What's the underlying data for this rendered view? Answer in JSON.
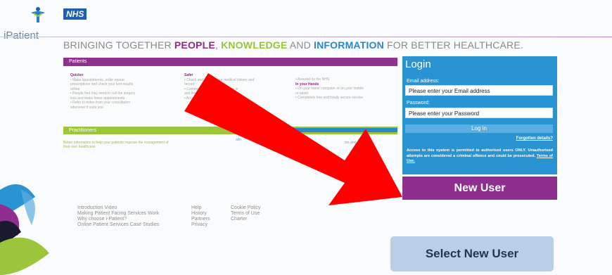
{
  "header": {
    "brand_name": "iPatient",
    "nhs_label": "NHS",
    "tagline_1": "BRINGING TOGETHER ",
    "tagline_people": "PEOPLE",
    "tagline_sep1": ", ",
    "tagline_knowledge": "KNOWLEDGE",
    "tagline_and": " AND ",
    "tagline_information": "INFORMATION",
    "tagline_end": " FOR BETTER HEALTHCARE."
  },
  "patients": {
    "bar_label": "Patients",
    "col1_heading": "Quicker",
    "col1_lines": [
      "• Make appointments, order repeat",
      "  prescriptions and check your test results",
      "  online",
      "• People find they need to call the surgery",
      "  less and make fewer appointments",
      "• Refer to notes from your consultation",
      "  whenever it suits you"
    ],
    "col2_heading": "Safer",
    "col2_lines": [
      "• Check and correct your medical history and",
      "  record",
      "• Communicate with consultants or",
      "  and feel involved",
      "• Access your records and when"
    ],
    "col3_heading": "In your Hands",
    "col3_lines": [
      "• Assured by the NHS",
      "• On your home computer or on your mobile",
      "  or tablet",
      "• Completely free and totally secure service"
    ]
  },
  "practitioners": {
    "bar_label": "Practitioners",
    "text": "Better information to help your patients improve the management of their own healthcare.",
    "side_note": "alth",
    "side_note2": "ms and"
  },
  "login": {
    "title": "Login",
    "email_label": "Email address:",
    "email_value": "Please enter your Email address",
    "password_label": "Password:",
    "password_value": "Please enter your Password",
    "login_button": "Log in",
    "forgot_link": "Forgotten details?",
    "warning_text": "Access to this system is permitted to authorised users ONLY. Unauthorised attempts are considered a criminal offence and could be prosecuted.",
    "terms_link": "Terms of Use."
  },
  "new_user_button": "New User",
  "footer": {
    "col1": [
      "Introduction Video",
      "Making Patient Facing Services Work",
      "Why choose i-Patient?",
      "Online Patient Services Case Studies"
    ],
    "col2": [
      "Help",
      "History",
      "Partners",
      "Privacy"
    ],
    "col3": [
      "Cookie Policy",
      "Terms of Use",
      "Charter"
    ]
  },
  "callout_label": "Select New User",
  "colors": {
    "purple": "#8e2e8f",
    "green": "#9dc53b",
    "blue": "#2a93d2",
    "arrow_red": "#ff0000"
  }
}
